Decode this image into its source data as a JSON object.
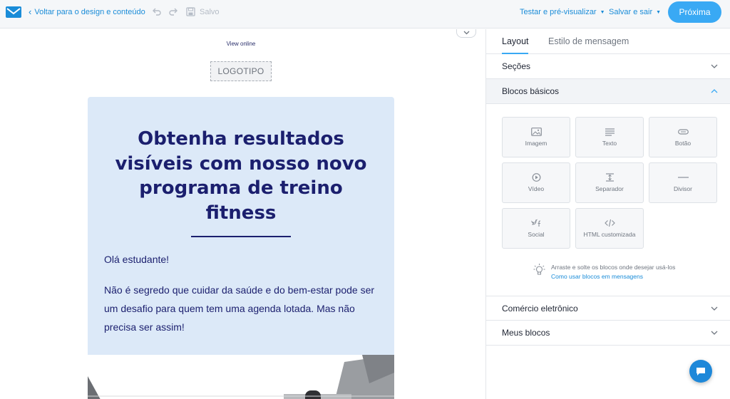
{
  "topbar": {
    "back_label": "Voltar para o design e conteúdo",
    "save_state": "Salvo",
    "test_preview_label": "Testar e pré-visualizar",
    "save_exit_label": "Salvar e sair",
    "next_label": "Próxima"
  },
  "canvas": {
    "view_online": "View online",
    "logo_placeholder": "LOGOTIPO",
    "hero_title": "Obtenha resultados visíveis com nosso novo programa de treino fitness",
    "greeting": "Olá estudante!",
    "body_text": "Não é segredo que cuidar da saúde e do bem-estar pode ser um desafio para quem tem uma agenda lotada. Mas não precisa ser assim!"
  },
  "panel": {
    "tabs": [
      {
        "label": "Layout",
        "active": true
      },
      {
        "label": "Estilo de mensagem",
        "active": false
      }
    ],
    "sections": [
      {
        "label": "Seções",
        "open": false
      },
      {
        "label": "Blocos básicos",
        "open": true
      },
      {
        "label": "Comércio eletrônico",
        "open": false
      },
      {
        "label": "Meus blocos",
        "open": false
      }
    ],
    "blocks": [
      {
        "label": "Imagem",
        "icon": "image-icon"
      },
      {
        "label": "Texto",
        "icon": "text-icon"
      },
      {
        "label": "Botão",
        "icon": "button-icon"
      },
      {
        "label": "Vídeo",
        "icon": "play-icon"
      },
      {
        "label": "Separador",
        "icon": "spacer-icon"
      },
      {
        "label": "Divisor",
        "icon": "divider-icon"
      },
      {
        "label": "Social",
        "icon": "social-icon"
      },
      {
        "label": "HTML customizada",
        "icon": "code-icon"
      }
    ],
    "hint": "Arraste e solte os blocos onde desejar usá-los",
    "hint_link": "Como usar blocos em mensagens"
  },
  "colors": {
    "accent": "#39a9f4",
    "link": "#1a8cd8",
    "hero_bg": "#dce9f8",
    "hero_text": "#1b1f6e"
  }
}
